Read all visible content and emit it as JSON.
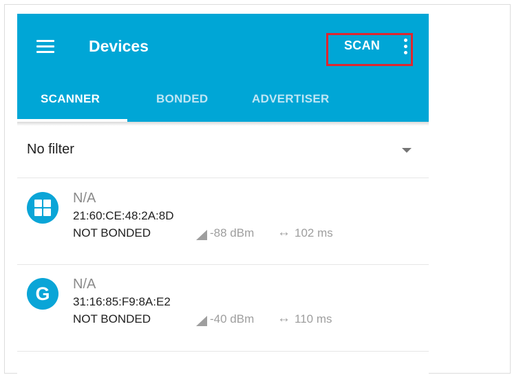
{
  "colors": {
    "primary": "#00a6d6",
    "highlight": "#e0262e",
    "avatar": "#0aa5d7"
  },
  "toolbar": {
    "menu_icon": "hamburger-menu-icon",
    "title": "Devices",
    "scan_label": "SCAN",
    "overflow_icon": "more-vert-icon"
  },
  "tabs": [
    {
      "label": "SCANNER",
      "active": true
    },
    {
      "label": "BONDED",
      "active": false
    },
    {
      "label": "ADVERTISER",
      "active": false
    }
  ],
  "filter": {
    "selected": "No filter",
    "icon": "dropdown-arrow-icon"
  },
  "devices": [
    {
      "icon": "windows-logo-icon",
      "name": "N/A",
      "address": "21:60:CE:48:2A:8D",
      "bond_state": "NOT BONDED",
      "rssi": "-88 dBm",
      "interval": "102 ms"
    },
    {
      "icon": "google-logo-icon",
      "avatar_letter": "G",
      "name": "N/A",
      "address": "31:16:85:F9:8A:E2",
      "bond_state": "NOT BONDED",
      "rssi": "-40 dBm",
      "interval": "110 ms"
    }
  ],
  "glyphs": {
    "interval_arrow": "↔"
  }
}
